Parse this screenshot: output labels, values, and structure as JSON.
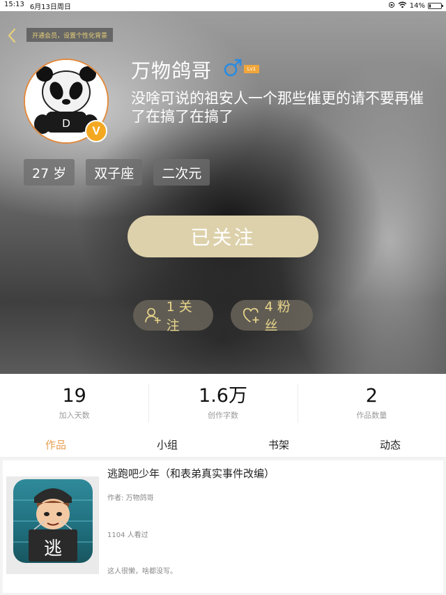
{
  "status_bar": {
    "time": "15:13",
    "date": "6月13日周日",
    "battery": "14%",
    "battery_level": 0.14
  },
  "header": {
    "vip_banner": "开通会员，设置个性化背景"
  },
  "profile": {
    "username": "万物鸽哥",
    "gender_symbol": "♂",
    "level": "Lv1",
    "vip_badge": "V",
    "bio": "没啥可说的祖安人一个那些催更的请不要再催了在搞了在搞了",
    "tags": [
      "27 岁",
      "双子座",
      "二次元"
    ],
    "follow_button": "已关注",
    "following_label": "1 关注",
    "fans_label": "4 粉丝"
  },
  "stats": [
    {
      "value": "19",
      "label": "加入天数"
    },
    {
      "value": "1.6万",
      "label": "创作字数"
    },
    {
      "value": "2",
      "label": "作品数量"
    }
  ],
  "tabs": [
    {
      "label": "作品",
      "active": true
    },
    {
      "label": "小组",
      "active": false
    },
    {
      "label": "书架",
      "active": false
    },
    {
      "label": "动态",
      "active": false
    }
  ],
  "work": {
    "title": "逃跑吧少年（和表弟真实事件改编）",
    "author": "作者: 万物鸽哥",
    "views": "1104 人看过",
    "description": "这人很懒，啥都没写。",
    "cover_char": "逃"
  },
  "colors": {
    "accent": "#e8a053",
    "follow_button": "#ddd1ab",
    "gender_blue": "#2a8be0",
    "vip_orange": "#f4a821"
  }
}
